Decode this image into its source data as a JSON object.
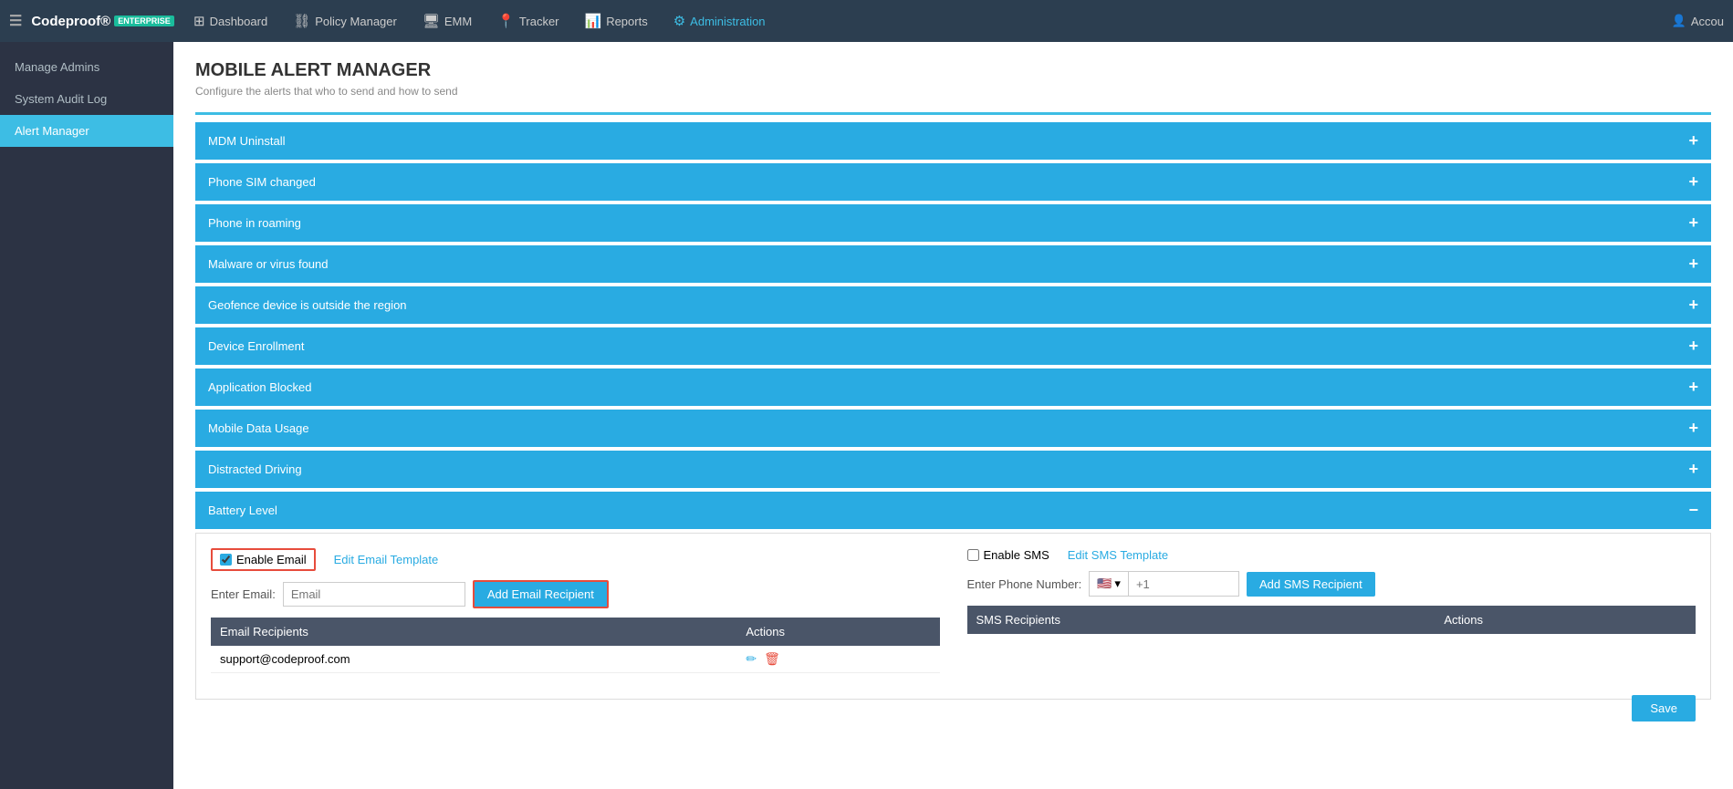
{
  "app": {
    "logo": "Codeproof®",
    "badge": "ENTERPRISE"
  },
  "nav": {
    "items": [
      {
        "id": "dashboard",
        "label": "Dashboard",
        "icon": "⊞",
        "active": false
      },
      {
        "id": "policy-manager",
        "label": "Policy Manager",
        "icon": "⛓",
        "active": false
      },
      {
        "id": "emm",
        "label": "EMM",
        "icon": "🖥",
        "active": false
      },
      {
        "id": "tracker",
        "label": "Tracker",
        "icon": "📍",
        "active": false
      },
      {
        "id": "reports",
        "label": "Reports",
        "icon": "📊",
        "active": false
      },
      {
        "id": "administration",
        "label": "Administration",
        "icon": "⚙",
        "active": true
      }
    ],
    "account_label": "Accou"
  },
  "sidebar": {
    "items": [
      {
        "id": "manage-admins",
        "label": "Manage Admins",
        "active": false
      },
      {
        "id": "system-audit-log",
        "label": "System Audit Log",
        "active": false
      },
      {
        "id": "alert-manager",
        "label": "Alert Manager",
        "active": true
      }
    ]
  },
  "page": {
    "title": "MOBILE ALERT MANAGER",
    "subtitle": "Configure the alerts that who to send and how to send"
  },
  "alerts": [
    {
      "id": "mdm-uninstall",
      "label": "MDM Uninstall",
      "expanded": false
    },
    {
      "id": "phone-sim-changed",
      "label": "Phone SIM changed",
      "expanded": false
    },
    {
      "id": "phone-in-roaming",
      "label": "Phone in roaming",
      "expanded": false
    },
    {
      "id": "malware-virus",
      "label": "Malware or virus found",
      "expanded": false
    },
    {
      "id": "geofence",
      "label": "Geofence device is outside the region",
      "expanded": false
    },
    {
      "id": "device-enrollment",
      "label": "Device Enrollment",
      "expanded": false
    },
    {
      "id": "application-blocked",
      "label": "Application Blocked",
      "expanded": false
    },
    {
      "id": "mobile-data-usage",
      "label": "Mobile Data Usage",
      "expanded": false
    },
    {
      "id": "distracted-driving",
      "label": "Distracted Driving",
      "expanded": false
    },
    {
      "id": "battery-level",
      "label": "Battery Level",
      "expanded": true
    }
  ],
  "expanded_panel": {
    "enable_email_label": "Enable Email",
    "edit_email_template_label": "Edit Email Template",
    "enter_email_label": "Enter Email:",
    "email_placeholder": "Email",
    "add_email_btn": "Add Email Recipient",
    "email_recipients_header": "Email Recipients",
    "actions_header": "Actions",
    "email_recipients": [
      {
        "email": "support@codeproof.com"
      }
    ],
    "enable_sms_label": "Enable SMS",
    "edit_sms_template_label": "Edit SMS Template",
    "enter_phone_label": "Enter Phone Number:",
    "phone_placeholder": "+1",
    "add_sms_btn": "Add SMS Recipient",
    "sms_recipients_header": "SMS Recipients",
    "sms_actions_header": "Actions",
    "sms_recipients": [],
    "save_label": "Save",
    "country_flag": "🇺🇸",
    "country_code": "+1"
  }
}
